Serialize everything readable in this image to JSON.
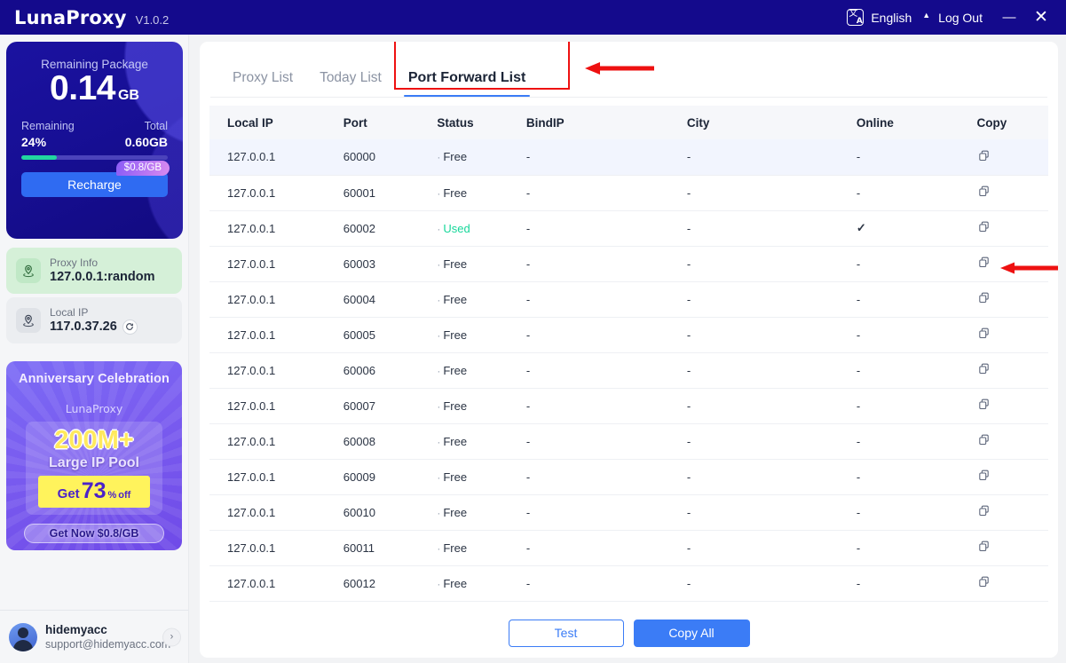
{
  "titlebar": {
    "brand": "LunaProxy",
    "version": "V1.0.2",
    "translate_icon_cn": "文",
    "translate_icon_en": "A",
    "language": "English",
    "caret": "▲",
    "logout": "Log Out",
    "minimize": "—",
    "close": "✕"
  },
  "sidebar": {
    "package": {
      "title": "Remaining Package",
      "amount": "0.14",
      "unit": "GB",
      "remaining_label": "Remaining",
      "remaining_value": "24%",
      "total_label": "Total",
      "total_value": "0.60GB",
      "progress_percent": 24,
      "price_badge": "$0.8/GB",
      "recharge_label": "Recharge"
    },
    "proxy_info": {
      "label": "Proxy Info",
      "value": "127.0.0.1:random"
    },
    "local_ip": {
      "label": "Local IP",
      "value": "117.0.37.26"
    },
    "promo": {
      "title": "Anniversary Celebration",
      "brand": "LunaProxy",
      "headline": "200M+",
      "subline": "Large IP Pool",
      "get_word": "Get",
      "discount_number": "73",
      "discount_percent": "%",
      "discount_off": "off",
      "cta": "Get Now $0.8/GB"
    },
    "user": {
      "name": "hidemyacc",
      "email": "support@hidemyacc.com",
      "chevron": "›"
    }
  },
  "main": {
    "tabs": [
      {
        "label": "Proxy List",
        "active": false
      },
      {
        "label": "Today List",
        "active": false
      },
      {
        "label": "Port Forward List",
        "active": true
      }
    ],
    "table": {
      "columns": [
        "Local IP",
        "Port",
        "Status",
        "BindIP",
        "City",
        "Online",
        "Copy"
      ],
      "rows": [
        {
          "local_ip": "127.0.0.1",
          "port": "60000",
          "status": "Free",
          "bindip": "-",
          "city": "-",
          "online": "-",
          "copy": "copy-icon",
          "highlight": true
        },
        {
          "local_ip": "127.0.0.1",
          "port": "60001",
          "status": "Free",
          "bindip": "-",
          "city": "-",
          "online": "-",
          "copy": "copy-icon",
          "highlight": false
        },
        {
          "local_ip": "127.0.0.1",
          "port": "60002",
          "status": "Used",
          "bindip": "-",
          "city": "-",
          "online": "✓",
          "copy": "copy-icon",
          "highlight": false
        },
        {
          "local_ip": "127.0.0.1",
          "port": "60003",
          "status": "Free",
          "bindip": "-",
          "city": "-",
          "online": "-",
          "copy": "copy-icon",
          "highlight": false
        },
        {
          "local_ip": "127.0.0.1",
          "port": "60004",
          "status": "Free",
          "bindip": "-",
          "city": "-",
          "online": "-",
          "copy": "copy-icon",
          "highlight": false
        },
        {
          "local_ip": "127.0.0.1",
          "port": "60005",
          "status": "Free",
          "bindip": "-",
          "city": "-",
          "online": "-",
          "copy": "copy-icon",
          "highlight": false
        },
        {
          "local_ip": "127.0.0.1",
          "port": "60006",
          "status": "Free",
          "bindip": "-",
          "city": "-",
          "online": "-",
          "copy": "copy-icon",
          "highlight": false
        },
        {
          "local_ip": "127.0.0.1",
          "port": "60007",
          "status": "Free",
          "bindip": "-",
          "city": "-",
          "online": "-",
          "copy": "copy-icon",
          "highlight": false
        },
        {
          "local_ip": "127.0.0.1",
          "port": "60008",
          "status": "Free",
          "bindip": "-",
          "city": "-",
          "online": "-",
          "copy": "copy-icon",
          "highlight": false
        },
        {
          "local_ip": "127.0.0.1",
          "port": "60009",
          "status": "Free",
          "bindip": "-",
          "city": "-",
          "online": "-",
          "copy": "copy-icon",
          "highlight": false
        },
        {
          "local_ip": "127.0.0.1",
          "port": "60010",
          "status": "Free",
          "bindip": "-",
          "city": "-",
          "online": "-",
          "copy": "copy-icon",
          "highlight": false
        },
        {
          "local_ip": "127.0.0.1",
          "port": "60011",
          "status": "Free",
          "bindip": "-",
          "city": "-",
          "online": "-",
          "copy": "copy-icon",
          "highlight": false
        },
        {
          "local_ip": "127.0.0.1",
          "port": "60012",
          "status": "Free",
          "bindip": "-",
          "city": "-",
          "online": "-",
          "copy": "copy-icon",
          "highlight": false
        }
      ]
    },
    "footer": {
      "test_label": "Test",
      "copy_all_label": "Copy All"
    }
  },
  "annotations": {
    "highlight_color": "#ee1111",
    "arrow_tabs": "left-arrow pointing at Port Forward List tab",
    "arrow_row": "left-arrow pointing at copy icon of port 60002"
  },
  "colors": {
    "titlebar": "#140a8c",
    "accent_blue": "#3b7cf6",
    "status_used_green": "#17d79a",
    "package_card": "#170f95",
    "annotation_red": "#ee1111"
  }
}
